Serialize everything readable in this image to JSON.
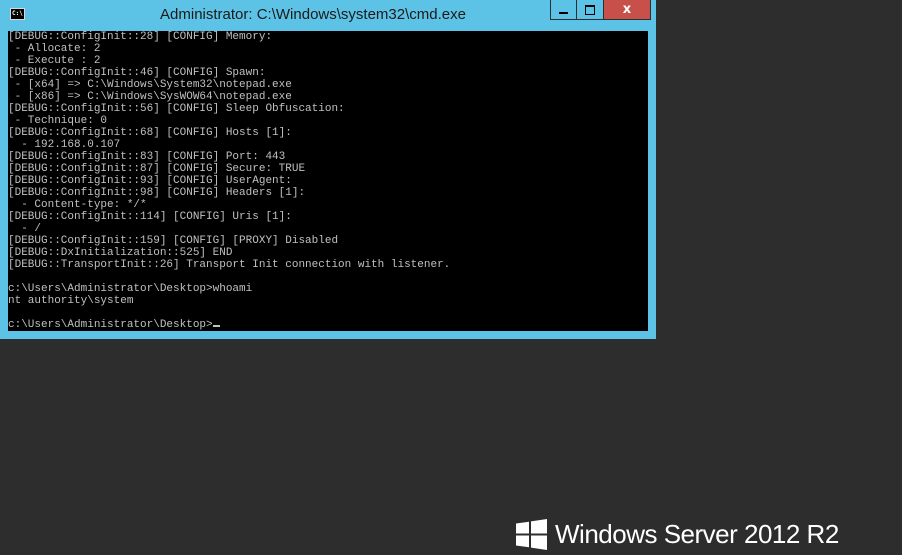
{
  "window": {
    "title": "Administrator: C:\\Windows\\system32\\cmd.exe",
    "icon_label": "C:\\.",
    "buttons": {
      "minimize": "minimize-icon",
      "maximize": "maximize-icon",
      "close": "x"
    }
  },
  "console": {
    "lines": [
      "[DEBUG::ConfigInit::28] [CONFIG] Memory:",
      " - Allocate: 2",
      " - Execute : 2",
      "[DEBUG::ConfigInit::46] [CONFIG] Spawn:",
      " - [x64] => C:\\Windows\\System32\\notepad.exe",
      " - [x86] => C:\\Windows\\SysWOW64\\notepad.exe",
      "[DEBUG::ConfigInit::56] [CONFIG] Sleep Obfuscation:",
      " - Technique: 0",
      "[DEBUG::ConfigInit::68] [CONFIG] Hosts [1]:",
      "  - 192.168.0.107",
      "[DEBUG::ConfigInit::83] [CONFIG] Port: 443",
      "[DEBUG::ConfigInit::87] [CONFIG] Secure: TRUE",
      "[DEBUG::ConfigInit::93] [CONFIG] UserAgent:",
      "[DEBUG::ConfigInit::98] [CONFIG] Headers [1]:",
      "  - Content-type: */*",
      "[DEBUG::ConfigInit::114] [CONFIG] Uris [1]:",
      "  - /",
      "[DEBUG::ConfigInit::159] [CONFIG] [PROXY] Disabled",
      "[DEBUG::DxInitialization::525] END",
      "[DEBUG::TransportInit::26] Transport Init connection with listener.",
      "",
      "c:\\Users\\Administrator\\Desktop>whoami",
      "nt authority\\system",
      ""
    ],
    "prompt": "c:\\Users\\Administrator\\Desktop>"
  },
  "branding": {
    "text": "Windows Server 2012 R2",
    "logo_icon": "windows-logo-icon"
  },
  "colors": {
    "frame": "#5dc3e6",
    "close_button": "#c7514a",
    "desktop": "#2d2d2d",
    "console_bg": "#000000",
    "console_fg": "#c0c0c0"
  }
}
